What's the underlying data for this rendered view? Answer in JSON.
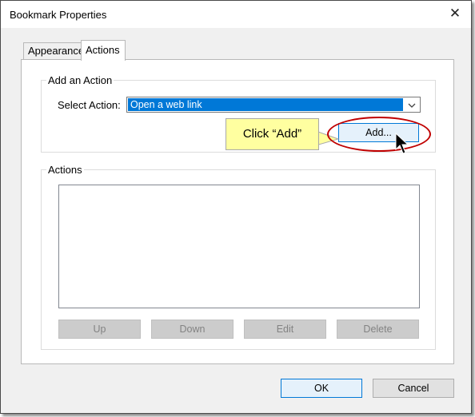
{
  "window": {
    "title": "Bookmark Properties",
    "close_glyph": "✕"
  },
  "tabs": [
    {
      "label": "Appearance",
      "active": false
    },
    {
      "label": "Actions",
      "active": true
    }
  ],
  "add_action": {
    "group_label": "Add an Action",
    "select_label": "Select Action:",
    "selected_value": "Open a web link",
    "add_button": "Add..."
  },
  "actions": {
    "group_label": "Actions",
    "buttons": {
      "up": "Up",
      "down": "Down",
      "edit": "Edit",
      "delete": "Delete"
    }
  },
  "footer": {
    "ok": "OK",
    "cancel": "Cancel"
  },
  "annotation": {
    "callout_text": "Click “Add”",
    "highlight_color": "#c00000",
    "callout_color": "#ffffa0"
  },
  "icons": {
    "close": "close-icon",
    "dropdown": "chevron-down-icon",
    "cursor": "mouse-pointer-icon"
  }
}
